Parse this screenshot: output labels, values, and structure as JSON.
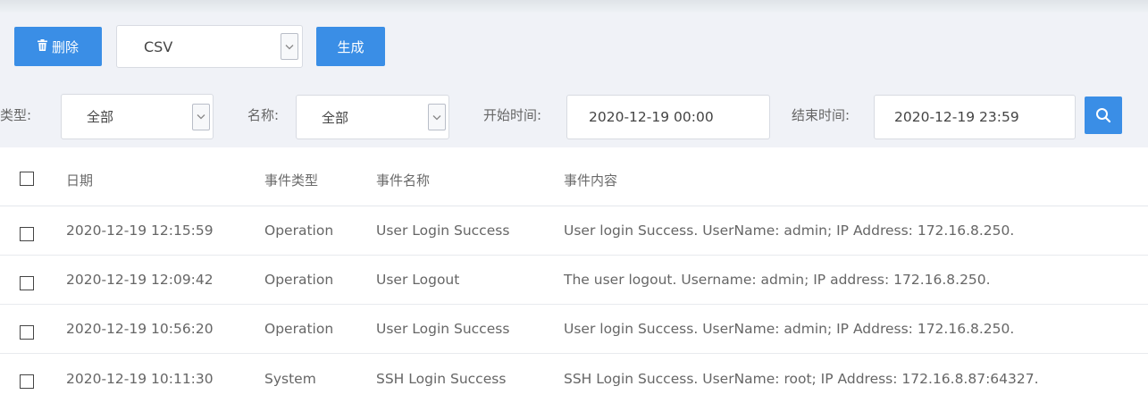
{
  "toolbar": {
    "delete_label": "删除",
    "format_value": "CSV",
    "generate_label": "生成"
  },
  "filters": {
    "type_label": "类型:",
    "type_value": "全部",
    "name_label": "名称:",
    "name_value": "全部",
    "start_label": "开始时间:",
    "start_value": "2020-12-19 00:00",
    "end_label": "结束时间:",
    "end_value": "2020-12-19 23:59",
    "search_icon": "search-icon"
  },
  "table": {
    "headers": {
      "date": "日期",
      "event_type": "事件类型",
      "event_name": "事件名称",
      "event_content": "事件内容"
    },
    "rows": [
      {
        "date": "2020-12-19 12:15:59",
        "type": "Operation",
        "name": "User Login Success",
        "content": "User login Success. UserName: admin; IP Address: 172.16.8.250."
      },
      {
        "date": "2020-12-19 12:09:42",
        "type": "Operation",
        "name": "User Logout",
        "content": "The user logout. Username: admin; IP address: 172.16.8.250."
      },
      {
        "date": "2020-12-19 10:56:20",
        "type": "Operation",
        "name": "User Login Success",
        "content": "User login Success. UserName: admin; IP Address: 172.16.8.250."
      },
      {
        "date": "2020-12-19 10:11:30",
        "type": "System",
        "name": "SSH Login Success",
        "content": "SSH Login Success. UserName: root; IP Address: 172.16.8.87:64327."
      }
    ]
  },
  "colors": {
    "accent": "#3a8ee6",
    "panel_bg": "#f0f2f7"
  }
}
